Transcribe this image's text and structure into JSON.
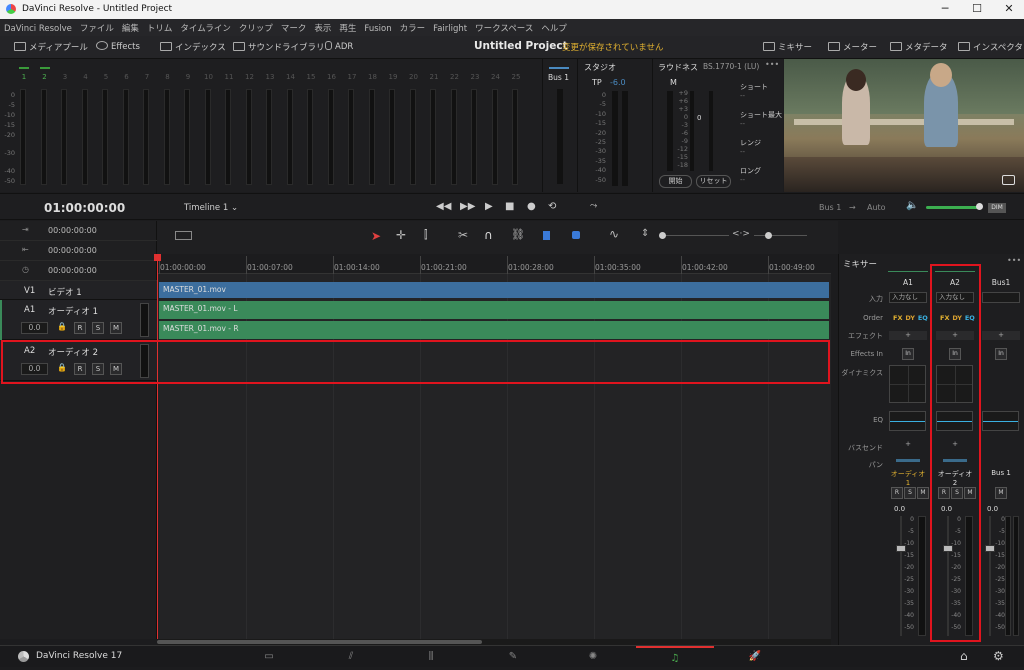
{
  "window": {
    "title": "DaVinci Resolve - Untitled Project",
    "minimize": "─",
    "maximize": "☐",
    "close": "✕"
  },
  "menu": [
    "DaVinci Resolve",
    "ファイル",
    "編集",
    "トリム",
    "タイムライン",
    "クリップ",
    "マーク",
    "表示",
    "再生",
    "Fusion",
    "カラー",
    "Fairlight",
    "ワークスペース",
    "ヘルプ"
  ],
  "toolbar": {
    "media_pool": "メディアプール",
    "effects": "Effects",
    "index": "インデックス",
    "sound_library": "サウンドライブラリ",
    "adr": "ADR",
    "project_title": "Untitled Project",
    "unsaved": "変更が保存されていません",
    "mixer": "ミキサー",
    "meters": "メーター",
    "metadata": "メタデータ",
    "inspector": "インスペクタ"
  },
  "meters": {
    "channels": [
      "1",
      "2",
      "3",
      "4",
      "5",
      "6",
      "7",
      "8",
      "9",
      "10",
      "11",
      "12",
      "13",
      "14",
      "15",
      "16",
      "17",
      "18",
      "19",
      "20",
      "21",
      "22",
      "23",
      "24",
      "25"
    ],
    "scale": [
      "0",
      "-5",
      "-10",
      "-15",
      "-20",
      "-30",
      "-40",
      "-50"
    ],
    "bus_label": "Bus 1"
  },
  "studio": {
    "title": "スタジオ",
    "tp_label": "TP",
    "tp_value": "-6.0",
    "scale": [
      "0",
      "-5",
      "-10",
      "-15",
      "-20",
      "-25",
      "-30",
      "-35",
      "-40",
      "-50"
    ]
  },
  "loudness": {
    "title": "ラウドネス",
    "standard": "BS.1770-1 (LU)",
    "m_label": "M",
    "m_value": "0",
    "scale": [
      "+9",
      "+6",
      "+3",
      "0",
      "-3",
      "-6",
      "-9",
      "-12",
      "-15",
      "-18"
    ],
    "short": "ショート",
    "short_max": "ショート最大",
    "range": "レンジ",
    "long": "ロング",
    "dash": "--",
    "pause": "開始",
    "reset": "リセット"
  },
  "transport": {
    "timecode": "01:00:00:00",
    "timeline": "Timeline 1",
    "bus": "Bus 1",
    "auto": "Auto",
    "dim": "DIM"
  },
  "timecodes": [
    "00:00:00:00",
    "00:00:00:00",
    "00:00:00:00"
  ],
  "ruler": [
    "01:00:00:00",
    "01:00:07:00",
    "01:00:14:00",
    "01:00:21:00",
    "01:00:28:00",
    "01:00:35:00",
    "01:00:42:00",
    "01:00:49:00"
  ],
  "tracks": [
    {
      "id": "V1",
      "name": "ビデオ 1",
      "clip": "MASTER_01.mov",
      "color": "#3c6e9e"
    },
    {
      "id": "A1",
      "name": "オーディオ 1",
      "vol": "0.0",
      "clip_l": "MASTER_01.mov - L",
      "clip_r": "MASTER_01.mov - R",
      "color": "#3a8a5a"
    },
    {
      "id": "A2",
      "name": "オーディオ 2",
      "vol": "0.0"
    }
  ],
  "track_buttons": {
    "r": "R",
    "s": "S",
    "m": "M"
  },
  "mixer": {
    "title": "ミキサー",
    "more": "•••",
    "rows": {
      "input": "入力",
      "order": "Order",
      "effects": "エフェクト",
      "effects_in": "Effects In",
      "dynamics": "ダイナミクス",
      "eq": "EQ",
      "bus_send": "バスセンド",
      "pan": "パン"
    },
    "channels": [
      {
        "header": "A1",
        "input": "入力なし",
        "name": "オーディオ 1",
        "vol": "0.0",
        "name_color": "#e0b030"
      },
      {
        "header": "A2",
        "input": "入力なし",
        "name": "オーディオ 2",
        "vol": "0.0",
        "name_color": "#dddddd"
      },
      {
        "header": "Bus1",
        "input": "",
        "name": "Bus 1",
        "vol": "0.0",
        "name_color": "#dddddd"
      }
    ],
    "fx": {
      "f": "FX",
      "d": "DY",
      "e": "EQ"
    },
    "in": "In",
    "plus": "+",
    "fader_scale": [
      "0",
      "-5",
      "-10",
      "-15",
      "-20",
      "-25",
      "-30",
      "-35",
      "-40",
      "-50"
    ]
  },
  "bottom": {
    "app": "DaVinci Resolve 17",
    "home": "⌂",
    "settings": "⚙"
  },
  "colors": {
    "accent": "#e0b030",
    "highlight_red": "#e0141e",
    "fairlight_active": "#e03030"
  }
}
